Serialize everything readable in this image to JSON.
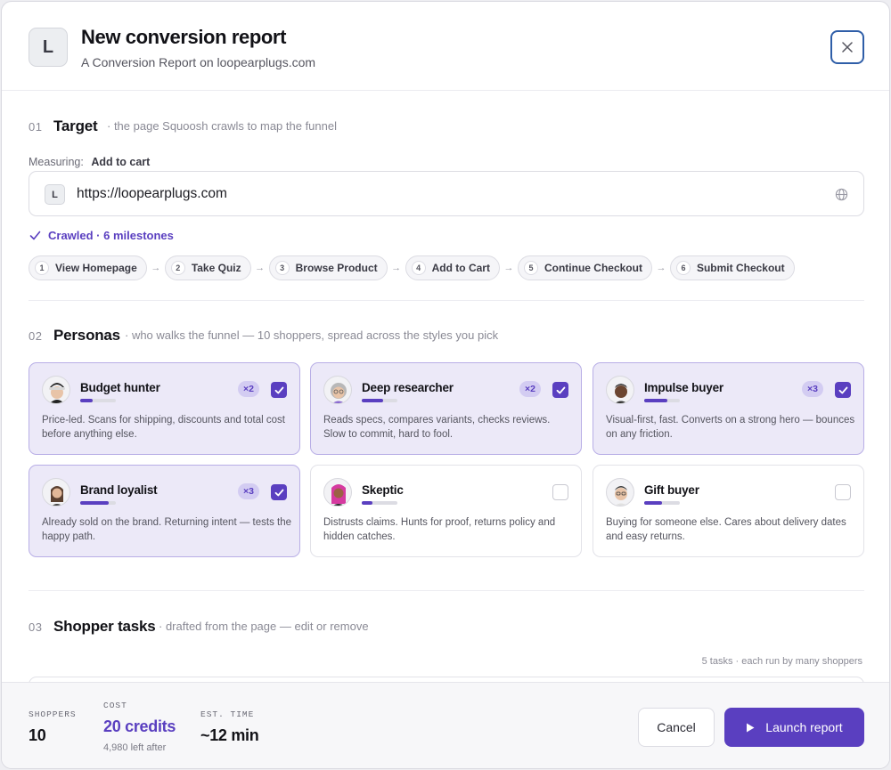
{
  "header": {
    "logo_letter": "L",
    "title": "New conversion report",
    "subtitle": "A Conversion Report on loopearplugs.com"
  },
  "target": {
    "num": "01",
    "title": "Target",
    "desc": "· the page Squoosh crawls to map the funnel",
    "measuring_label": "Measuring:",
    "measuring_value": "Add to cart",
    "url_favicon": "L",
    "url_value": "https://loopearplugs.com",
    "crawled_text": "Crawled · 6 milestones",
    "milestones": [
      {
        "num": "1",
        "label": "View Homepage"
      },
      {
        "num": "2",
        "label": "Take Quiz"
      },
      {
        "num": "3",
        "label": "Browse Product"
      },
      {
        "num": "4",
        "label": "Add to Cart"
      },
      {
        "num": "5",
        "label": "Continue Checkout"
      },
      {
        "num": "6",
        "label": "Submit Checkout"
      }
    ]
  },
  "personas": {
    "num": "02",
    "title": "Personas",
    "desc": "· who walks the funnel — 10 shoppers, spread across the styles you pick",
    "items": [
      {
        "name": "Budget hunter",
        "mult": "×2",
        "selected": true,
        "level": 0.35,
        "desc": "Price-led. Scans for shipping, discounts and total cost before anything else.",
        "avatar": "budget-hunter-avatar"
      },
      {
        "name": "Deep researcher",
        "mult": "×2",
        "selected": true,
        "level": 0.6,
        "desc": "Reads specs, compares variants, checks reviews. Slow to commit, hard to fool.",
        "avatar": "deep-researcher-avatar"
      },
      {
        "name": "Impulse buyer",
        "mult": "×3",
        "selected": true,
        "level": 0.65,
        "desc": "Visual-first, fast. Converts on a strong hero — bounces on any friction.",
        "avatar": "impulse-buyer-avatar"
      },
      {
        "name": "Brand loyalist",
        "mult": "×3",
        "selected": true,
        "level": 0.8,
        "desc": "Already sold on the brand. Returning intent — tests the happy path.",
        "avatar": "brand-loyalist-avatar"
      },
      {
        "name": "Skeptic",
        "mult": "",
        "selected": false,
        "level": 0.3,
        "desc": "Distrusts claims. Hunts for proof, returns policy and hidden catches.",
        "avatar": "skeptic-avatar"
      },
      {
        "name": "Gift buyer",
        "mult": "",
        "selected": false,
        "level": 0.5,
        "desc": "Buying for someone else. Cares about delivery dates and easy returns.",
        "avatar": "gift-buyer-avatar"
      }
    ]
  },
  "tasks": {
    "num": "03",
    "title": "Shopper tasks",
    "desc": "· drafted from the page — edit or remove",
    "count_text": "5 tasks · each run by many shoppers"
  },
  "footer": {
    "shoppers_label": "SHOPPERS",
    "shoppers_value": "10",
    "cost_label": "COST",
    "cost_value": "20 credits",
    "cost_sub": "4,980 left after",
    "time_label": "EST. TIME",
    "time_value": "~12 min",
    "cancel_label": "Cancel",
    "launch_label": "Launch report"
  },
  "colors": {
    "accent": "#5a3fc0",
    "selected_card_bg": "#ece9f8",
    "close_border": "#2f5ea8"
  }
}
